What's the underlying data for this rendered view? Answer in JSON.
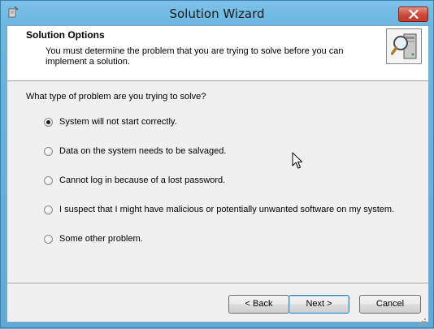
{
  "window": {
    "title": "Solution Wizard"
  },
  "header": {
    "title": "Solution Options",
    "description": "You must determine the problem that you are trying to solve before you can implement a solution."
  },
  "question": "What type of problem are you trying to solve?",
  "options": [
    {
      "label": "System will not start correctly.",
      "selected": true
    },
    {
      "label": "Data on the system needs to be salvaged.",
      "selected": false
    },
    {
      "label": "Cannot log in because of a lost password.",
      "selected": false
    },
    {
      "label": "I suspect that I might have malicious or potentially unwanted software on my system.",
      "selected": false
    },
    {
      "label": "Some other problem.",
      "selected": false
    }
  ],
  "buttons": {
    "back": "< Back",
    "next": "Next >",
    "cancel": "Cancel"
  },
  "colors": {
    "frame": "#6cb6e0",
    "close": "#c9493a",
    "panel": "#f0f0f0",
    "default_button_border": "#3c7fb1"
  },
  "icons": {
    "app": "wizard-wand-icon",
    "close": "close-icon",
    "header": "computer-magnifier-icon",
    "cursor": "mouse-pointer-icon"
  }
}
